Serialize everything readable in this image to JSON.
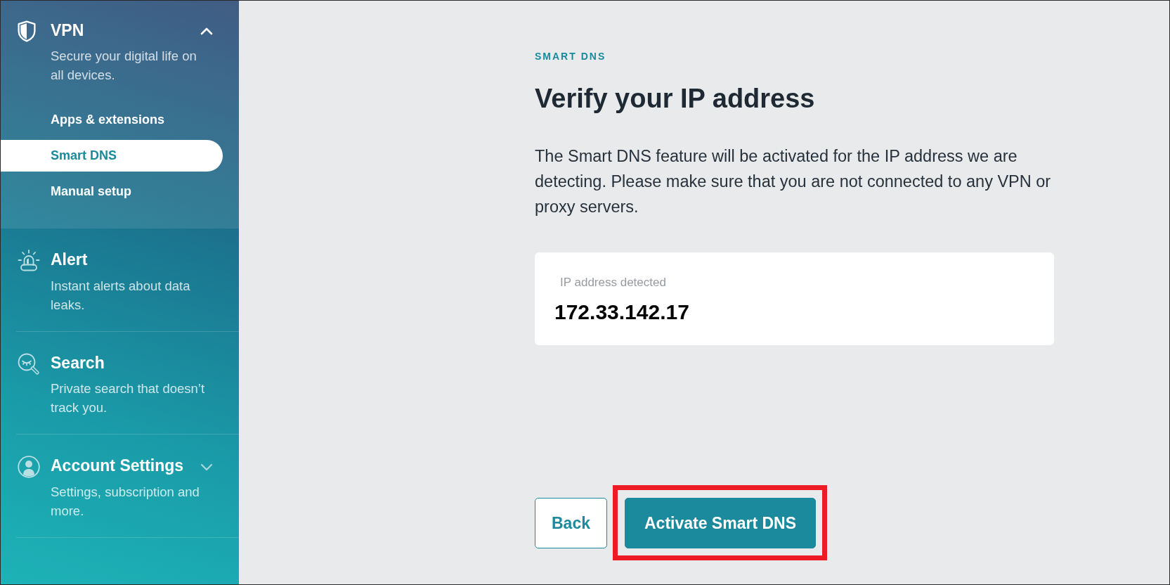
{
  "sidebar": {
    "sections": [
      {
        "kind": "vpn",
        "title": "VPN",
        "description": "Secure your digital life on all devices.",
        "expanded": true,
        "items": [
          {
            "label": "Apps & extensions",
            "selected": false
          },
          {
            "label": "Smart DNS",
            "selected": true
          },
          {
            "label": "Manual setup",
            "selected": false
          }
        ]
      },
      {
        "kind": "alert",
        "title": "Alert",
        "description": "Instant alerts about data leaks."
      },
      {
        "kind": "search",
        "title": "Search",
        "description": "Private search that doesn’t track you."
      },
      {
        "kind": "account",
        "title": "Account Settings",
        "description": "Settings, subscription and more.",
        "expanded": false
      }
    ]
  },
  "main": {
    "section_label": "SMART DNS",
    "title": "Verify your IP address",
    "description": "The Smart DNS feature will be activated for the IP address we are detecting. Please make sure that you are not connected to any VPN or proxy servers.",
    "ip_card": {
      "label": "IP address detected",
      "value": "172.33.142.17"
    },
    "actions": [
      {
        "label": "Back",
        "kind": "secondary",
        "highlighted": false
      },
      {
        "label": "Activate Smart DNS",
        "kind": "primary",
        "highlighted": true
      }
    ]
  }
}
